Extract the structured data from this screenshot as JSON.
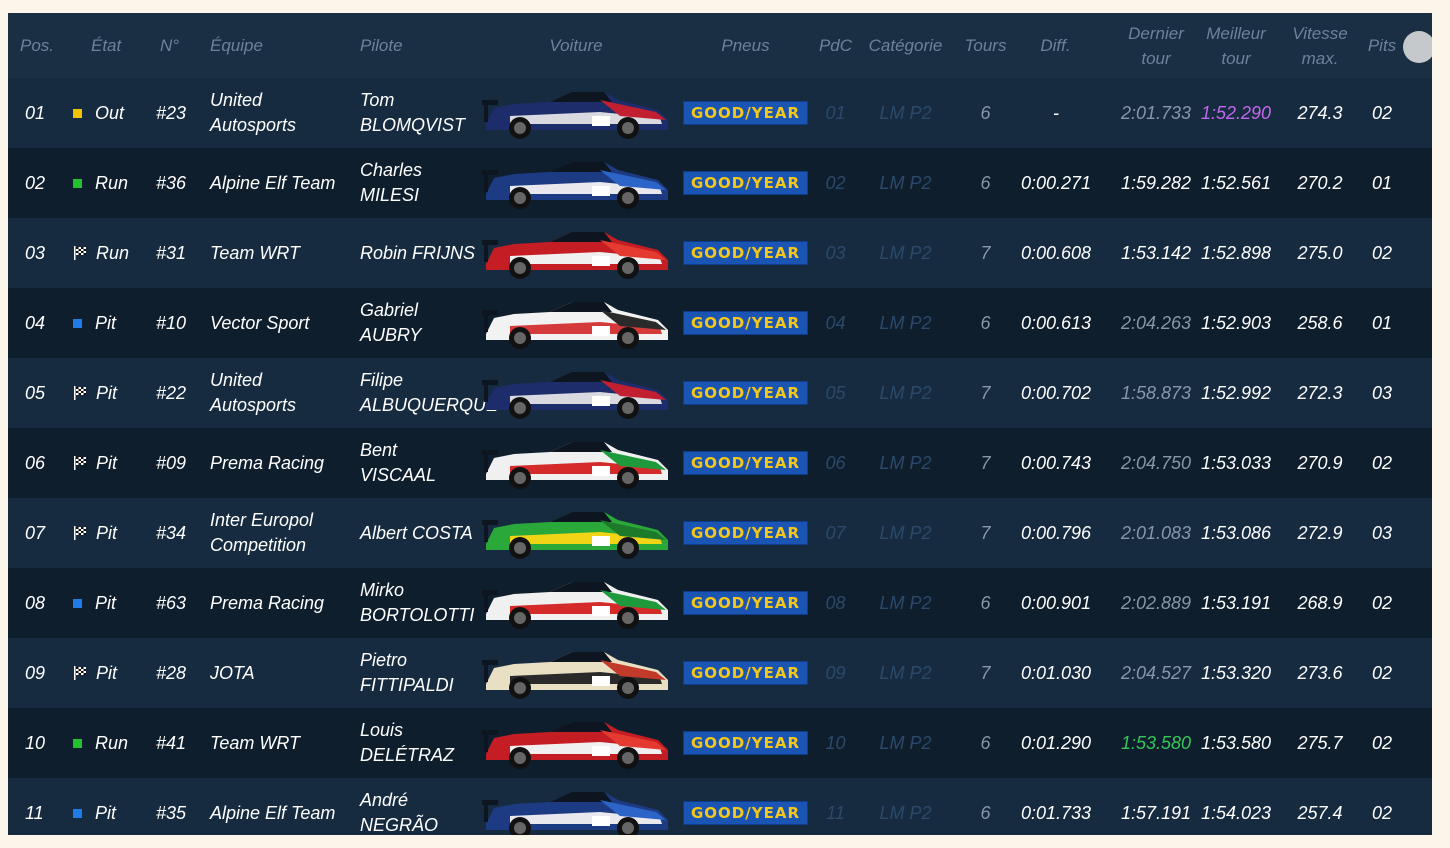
{
  "header": {
    "pos": "Pos.",
    "etat": "État",
    "num": "N°",
    "equipe": "Équipe",
    "pilote": "Pilote",
    "voiture": "Voiture",
    "pneus": "Pneus",
    "pdc": "PdC",
    "categorie": "Catégorie",
    "tours": "Tours",
    "diff": "Diff.",
    "dernier_tour": "Dernier tour",
    "meilleur_tour": "Meilleur tour",
    "vitesse_max": "Vitesse max.",
    "pits": "Pits"
  },
  "tyre_brand": "GOOD/YEAR",
  "colors": {
    "flag_yellow": "#f2c200",
    "flag_green": "#22c32f",
    "flag_blue": "#1f7be8",
    "best_overall": "#c268ee",
    "personal_best": "#34c759",
    "goodyear_blue": "#1b55b4",
    "goodyear_yellow": "#f5c817"
  },
  "rows": [
    {
      "pos": "01",
      "flag": "yellow",
      "etat": "Out",
      "num": "#23",
      "team": "United Autosports",
      "driver": "Tom BLOMQVIST",
      "livery": [
        "#1d2d6b",
        "#d9d9e0",
        "#c22030"
      ],
      "pdc": "01",
      "cat": "LM P2",
      "laps": "6",
      "laps_dim": true,
      "diff": "-",
      "last": "2:01.733",
      "last_style": "dim",
      "best": "1:52.290",
      "best_style": "purple",
      "speed": "274.3",
      "pits": "02"
    },
    {
      "pos": "02",
      "flag": "green",
      "etat": "Run",
      "num": "#36",
      "team": "Alpine Elf Team",
      "driver": "Charles MILESI",
      "livery": [
        "#1d3b82",
        "#e8e8ee",
        "#2c64c8"
      ],
      "pdc": "02",
      "cat": "LM P2",
      "laps": "6",
      "laps_dim": true,
      "diff": "0:00.271",
      "last": "1:59.282",
      "last_style": "",
      "best": "1:52.561",
      "best_style": "",
      "speed": "270.2",
      "pits": "01"
    },
    {
      "pos": "03",
      "flag": "chequered",
      "etat": "Run",
      "num": "#31",
      "team": "Team WRT",
      "driver": "Robin FRIJNS",
      "livery": [
        "#c41e24",
        "#f0f0f0",
        "#e53a30"
      ],
      "pdc": "03",
      "cat": "LM P2",
      "laps": "7",
      "laps_dim": true,
      "diff": "0:00.608",
      "last": "1:53.142",
      "last_style": "",
      "best": "1:52.898",
      "best_style": "",
      "speed": "275.0",
      "pits": "02"
    },
    {
      "pos": "04",
      "flag": "blue",
      "etat": "Pit",
      "num": "#10",
      "team": "Vector Sport",
      "driver": "Gabriel AUBRY",
      "livery": [
        "#f2f2f2",
        "#d43a3a",
        "#2a2a2a"
      ],
      "pdc": "04",
      "cat": "LM P2",
      "laps": "6",
      "laps_dim": true,
      "diff": "0:00.613",
      "last": "2:04.263",
      "last_style": "dim",
      "best": "1:52.903",
      "best_style": "",
      "speed": "258.6",
      "pits": "01"
    },
    {
      "pos": "05",
      "flag": "chequered",
      "etat": "Pit",
      "num": "#22",
      "team": "United Autosports",
      "driver": "Filipe ALBUQUERQUE",
      "livery": [
        "#1d2d6b",
        "#d9d9e0",
        "#c22030"
      ],
      "pdc": "05",
      "cat": "LM P2",
      "laps": "7",
      "laps_dim": true,
      "diff": "0:00.702",
      "last": "1:58.873",
      "last_style": "dim",
      "best": "1:52.992",
      "best_style": "",
      "speed": "272.3",
      "pits": "03"
    },
    {
      "pos": "06",
      "flag": "chequered",
      "etat": "Pit",
      "num": "#09",
      "team": "Prema Racing",
      "driver": "Bent VISCAAL",
      "livery": [
        "#f0f0f0",
        "#d42a2a",
        "#1e9a3c"
      ],
      "pdc": "06",
      "cat": "LM P2",
      "laps": "7",
      "laps_dim": true,
      "diff": "0:00.743",
      "last": "2:04.750",
      "last_style": "dim",
      "best": "1:53.033",
      "best_style": "",
      "speed": "270.9",
      "pits": "02"
    },
    {
      "pos": "07",
      "flag": "chequered",
      "etat": "Pit",
      "num": "#34",
      "team": "Inter Europol Competition",
      "driver": "Albert COSTA",
      "livery": [
        "#2aa83a",
        "#f2d417",
        "#1c7a2a"
      ],
      "pdc": "07",
      "cat": "LM P2",
      "laps": "7",
      "laps_dim": true,
      "diff": "0:00.796",
      "last": "2:01.083",
      "last_style": "dim",
      "best": "1:53.086",
      "best_style": "",
      "speed": "272.9",
      "pits": "03"
    },
    {
      "pos": "08",
      "flag": "blue",
      "etat": "Pit",
      "num": "#63",
      "team": "Prema Racing",
      "driver": "Mirko BORTOLOTTI",
      "livery": [
        "#f0f0f0",
        "#d42a2a",
        "#1e9a3c"
      ],
      "pdc": "08",
      "cat": "LM P2",
      "laps": "6",
      "laps_dim": true,
      "diff": "0:00.901",
      "last": "2:02.889",
      "last_style": "dim",
      "best": "1:53.191",
      "best_style": "",
      "speed": "268.9",
      "pits": "02"
    },
    {
      "pos": "09",
      "flag": "chequered",
      "etat": "Pit",
      "num": "#28",
      "team": "JOTA",
      "driver": "Pietro FITTIPALDI",
      "livery": [
        "#e9e0c4",
        "#2a2a2a",
        "#c23a2a"
      ],
      "pdc": "09",
      "cat": "LM P2",
      "laps": "7",
      "laps_dim": true,
      "diff": "0:01.030",
      "last": "2:04.527",
      "last_style": "dim",
      "best": "1:53.320",
      "best_style": "",
      "speed": "273.6",
      "pits": "02"
    },
    {
      "pos": "10",
      "flag": "green",
      "etat": "Run",
      "num": "#41",
      "team": "Team WRT",
      "driver": "Louis DELÉTRAZ",
      "livery": [
        "#c41e24",
        "#f0f0f0",
        "#e53a30"
      ],
      "pdc": "10",
      "cat": "LM P2",
      "laps": "6",
      "laps_dim": true,
      "diff": "0:01.290",
      "last": "1:53.580",
      "last_style": "green",
      "best": "1:53.580",
      "best_style": "",
      "speed": "275.7",
      "pits": "02"
    },
    {
      "pos": "11",
      "flag": "blue",
      "etat": "Pit",
      "num": "#35",
      "team": "Alpine Elf Team",
      "driver": "André NEGRÃO",
      "livery": [
        "#1d3b82",
        "#e8e8ee",
        "#2c64c8"
      ],
      "pdc": "11",
      "cat": "LM P2",
      "laps": "6",
      "laps_dim": true,
      "diff": "0:01.733",
      "last": "1:57.191",
      "last_style": "",
      "best": "1:54.023",
      "best_style": "",
      "speed": "257.4",
      "pits": "02"
    }
  ]
}
